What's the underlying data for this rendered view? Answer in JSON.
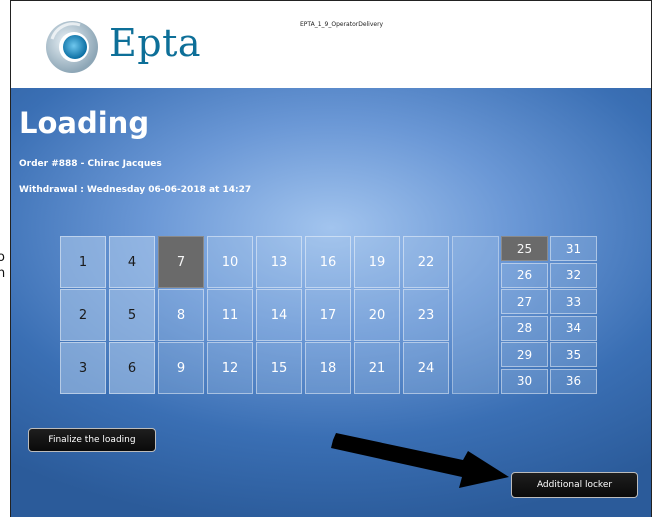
{
  "header": {
    "brand": "Epta",
    "screen_id": "EPTA_1_9_OperatorDelivery",
    "brand_color": "#0d6f98"
  },
  "page": {
    "title": "Loading",
    "order": "Order #888 - Chirac Jacques",
    "withdrawal": "Withdrawal : Wednesday 06-06-2018 at 14:27"
  },
  "lockers": {
    "selected": "7",
    "large": [
      {
        "n": "1",
        "state": "filled"
      },
      {
        "n": "2",
        "state": "filled"
      },
      {
        "n": "3",
        "state": "filled"
      },
      {
        "n": "4",
        "state": "filled"
      },
      {
        "n": "5",
        "state": "filled"
      },
      {
        "n": "6",
        "state": "filled"
      },
      {
        "n": "7",
        "state": "selected"
      },
      {
        "n": "8",
        "state": "empty"
      },
      {
        "n": "9",
        "state": "empty"
      },
      {
        "n": "10",
        "state": "empty"
      },
      {
        "n": "11",
        "state": "empty"
      },
      {
        "n": "12",
        "state": "empty"
      },
      {
        "n": "13",
        "state": "empty"
      },
      {
        "n": "14",
        "state": "empty"
      },
      {
        "n": "15",
        "state": "empty"
      },
      {
        "n": "16",
        "state": "empty"
      },
      {
        "n": "17",
        "state": "empty"
      },
      {
        "n": "18",
        "state": "empty"
      },
      {
        "n": "19",
        "state": "empty"
      },
      {
        "n": "20",
        "state": "empty"
      },
      {
        "n": "21",
        "state": "empty"
      },
      {
        "n": "22",
        "state": "empty"
      },
      {
        "n": "23",
        "state": "empty"
      },
      {
        "n": "24",
        "state": "empty"
      }
    ],
    "small": [
      {
        "n": "25",
        "state": "selected"
      },
      {
        "n": "26",
        "state": "empty"
      },
      {
        "n": "27",
        "state": "empty"
      },
      {
        "n": "28",
        "state": "empty"
      },
      {
        "n": "29",
        "state": "empty"
      },
      {
        "n": "30",
        "state": "empty"
      },
      {
        "n": "31",
        "state": "empty"
      },
      {
        "n": "32",
        "state": "empty"
      },
      {
        "n": "33",
        "state": "empty"
      },
      {
        "n": "34",
        "state": "empty"
      },
      {
        "n": "35",
        "state": "empty"
      },
      {
        "n": "36",
        "state": "empty"
      }
    ]
  },
  "buttons": {
    "finalize": "Finalize the loading",
    "additional": "Additional locker"
  },
  "side_glyphs": [
    "o",
    "n"
  ],
  "icons": {
    "logo": "epta-logo-icon",
    "arrow": "pointer-arrow-icon"
  }
}
